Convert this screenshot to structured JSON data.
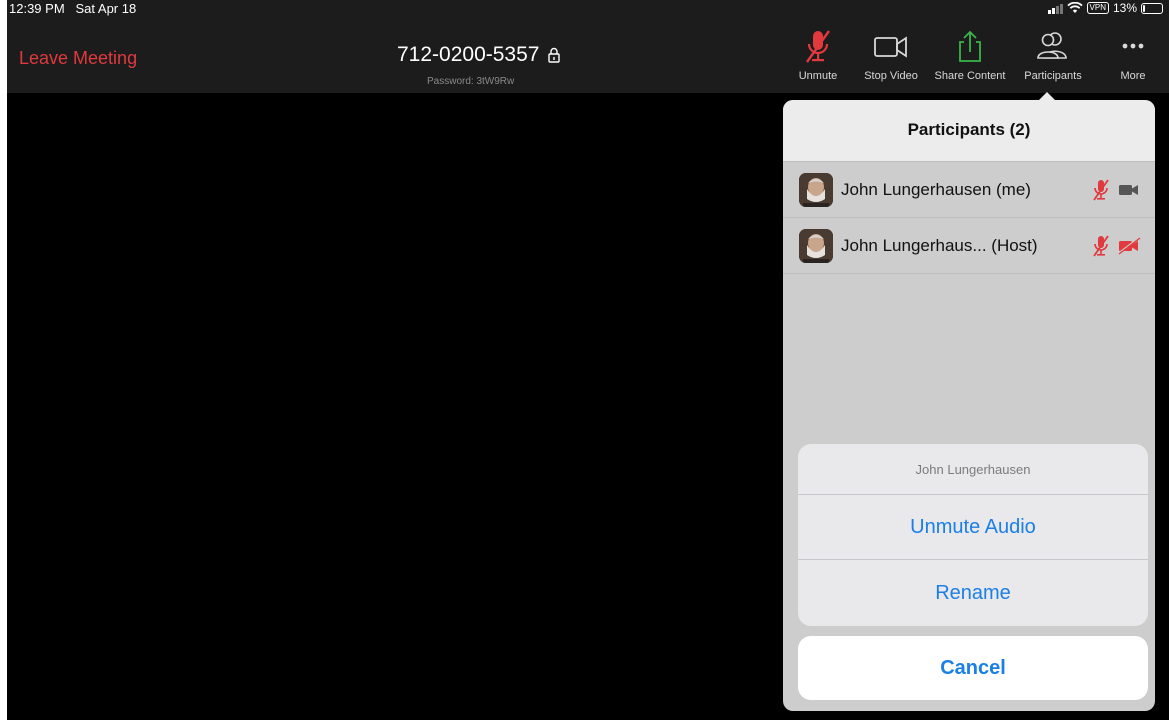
{
  "status_bar": {
    "time": "12:39 PM",
    "date": "Sat Apr 18",
    "vpn": "VPN",
    "battery_text": "13%",
    "battery_level": 0.13
  },
  "toolbar": {
    "leave_label": "Leave Meeting",
    "meeting_id": "712-0200-5357",
    "password": "Password: 3tW9Rw",
    "buttons": [
      {
        "label": "Unmute",
        "icon": "mic-muted-icon"
      },
      {
        "label": "Stop Video",
        "icon": "video-camera-icon"
      },
      {
        "label": "Share Content",
        "icon": "share-icon"
      },
      {
        "label": "Participants",
        "icon": "participants-icon"
      },
      {
        "label": "More",
        "icon": "more-icon"
      }
    ]
  },
  "participants": {
    "title": "Participants (2)",
    "list": [
      {
        "name": "John Lungerhausen (me)",
        "mic": "muted",
        "video": "on"
      },
      {
        "name": "John Lungerhaus... (Host)",
        "mic": "muted",
        "video": "off"
      }
    ]
  },
  "action_sheet": {
    "title": "John Lungerhausen",
    "buttons": [
      "Unmute Audio",
      "Rename"
    ],
    "cancel": "Cancel"
  },
  "colors": {
    "leave": "#e0393e",
    "muted": "#e0393e",
    "share": "#39b54a",
    "action": "#1a7fe6"
  }
}
